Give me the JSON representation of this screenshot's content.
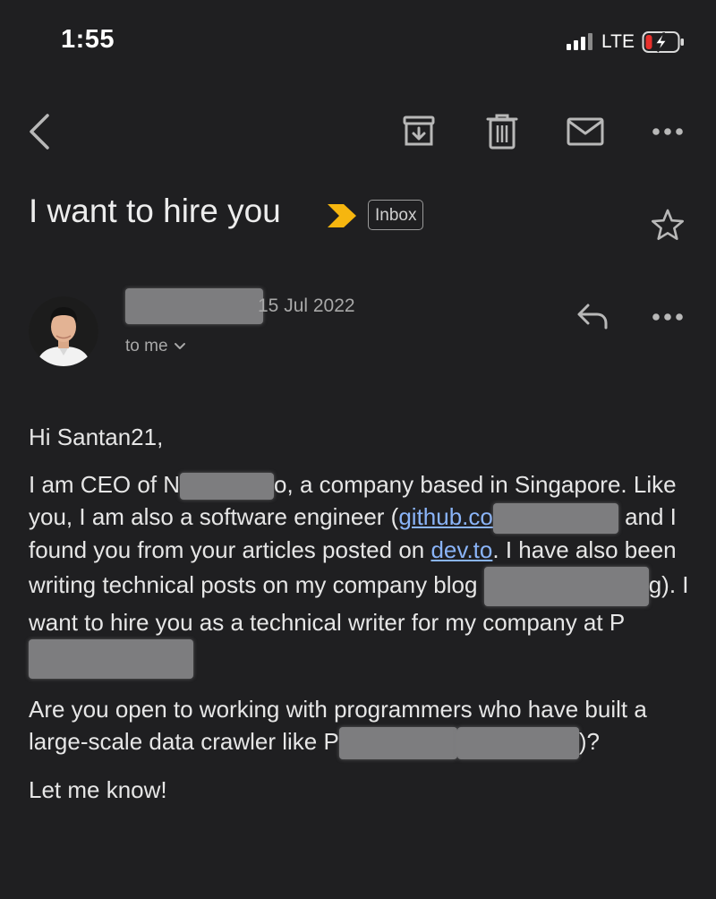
{
  "status_bar": {
    "time": "1:55",
    "network": "LTE"
  },
  "toolbar": {
    "back_icon": "chevron-left-icon",
    "archive_icon": "archive-icon",
    "delete_icon": "trash-icon",
    "mark_unread_icon": "mail-icon",
    "more_icon": "more-horizontal-icon"
  },
  "email": {
    "subject": "I want to hire you",
    "label": "Inbox",
    "date_fragment": "15 Jul 2022",
    "recipient": "to me",
    "body": {
      "greeting": "Hi Santan21,",
      "p1_a": "I am CEO of N",
      "p1_b": "o, a company based in Singapore. Like you, I am also a software engineer (",
      "p1_link1": "github.co",
      "p1_c": " and I found you from your articles posted on ",
      "p1_link2": "dev.to",
      "p1_d": ". I have also been writing technical posts on my company blog ",
      "p1_e": "g). I want to hire you as a technical writer for my company at P",
      "p2_a": "Are you open to working with programmers who have built a large-scale data crawler like P",
      "p2_b": ")?",
      "closing": "Let me know!"
    }
  },
  "colors": {
    "background": "#1f1f21",
    "text": "#e6e6e6",
    "link": "#8ab4f8",
    "important_marker": "#f6b60f",
    "redaction": "#7d7d7f"
  }
}
